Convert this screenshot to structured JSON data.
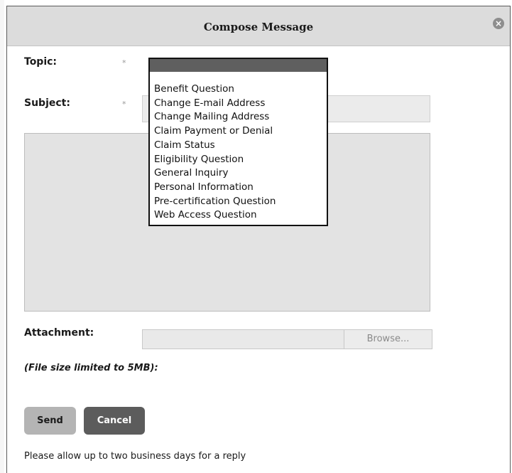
{
  "dialog": {
    "title": "Compose Message",
    "close_icon": "close-circle-icon"
  },
  "form": {
    "topic_label": "Topic:",
    "subject_label": "Subject:",
    "required_marker": "*",
    "subject_value": "",
    "message_value": "",
    "attachment_label": "Attachment:",
    "attachment_value": "",
    "browse_label": "Browse...",
    "file_size_note": "(File size limited to 5MB):"
  },
  "topic_dropdown": {
    "selected_value": "",
    "options": [
      "Benefit Question",
      "Change E-mail Address",
      "Change Mailing Address",
      "Claim Payment or Denial",
      "Claim Status",
      "Eligibility Question",
      "General Inquiry",
      "Personal Information",
      "Pre-certification Question",
      "Web Access Question"
    ]
  },
  "actions": {
    "send_label": "Send",
    "cancel_label": "Cancel"
  },
  "footer": {
    "note": "Please allow up to two business days for a reply"
  },
  "icons": {
    "scroll_up": "chevron-up-icon",
    "scroll_down": "chevron-down-icon"
  }
}
